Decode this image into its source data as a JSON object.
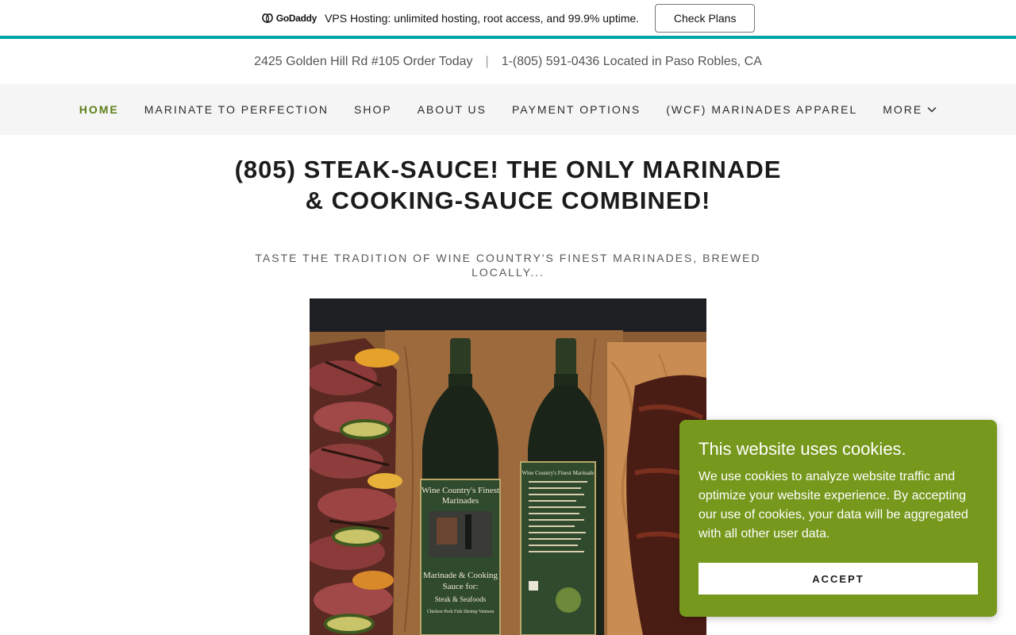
{
  "promo": {
    "brand": "GoDaddy",
    "text": "VPS Hosting: unlimited hosting, root access, and 99.9% uptime.",
    "button_label": "Check Plans",
    "rule_color": "#00a4a6"
  },
  "contact": {
    "address": "2425 Golden Hill Rd #105 Order Today",
    "separator": "|",
    "phone_location": "1-(805) 591-0436 Located in Paso Robles, CA"
  },
  "nav": {
    "items": [
      {
        "label": "HOME",
        "active": true
      },
      {
        "label": "MARINATE TO PERFECTION"
      },
      {
        "label": "SHOP"
      },
      {
        "label": "ABOUT US"
      },
      {
        "label": "PAYMENT OPTIONS"
      },
      {
        "label": "(WCF) MARINADES APPAREL"
      },
      {
        "label": "MORE",
        "icon": "chevron-down-icon"
      }
    ],
    "active_color": "#5d7f18"
  },
  "hero": {
    "headline_line1": "(805) STEAK-SAUCE! THE ONLY MARINADE",
    "headline_line2": "& COOKING-SAUCE COMBINED!",
    "tagline_line1": "TASTE THE TRADITION OF WINE COUNTRY'S FINEST MARINADES, BREWED",
    "tagline_line2": "LOCALLY..."
  },
  "photo": {
    "bottle_label_top": "Wine Country's Finest",
    "bottle_label_brand": "Marinades",
    "bottle_label_mid": "Marinade & Cooking",
    "bottle_label_sub": "Sauce for:",
    "bottle_label_uses": "Steak & Seafoods",
    "bottle_label_meats": "Chicken Pork Fish Shrimp Venison",
    "back_label_title": "Wine Country's Finest Marinade"
  },
  "cookie": {
    "title": "This website uses cookies.",
    "body": "We use cookies to analyze website traffic and optimize your website experience. By accepting our use of cookies, your data will be aggregated with all other user data.",
    "button_label": "ACCEPT",
    "background": "#76981c"
  }
}
